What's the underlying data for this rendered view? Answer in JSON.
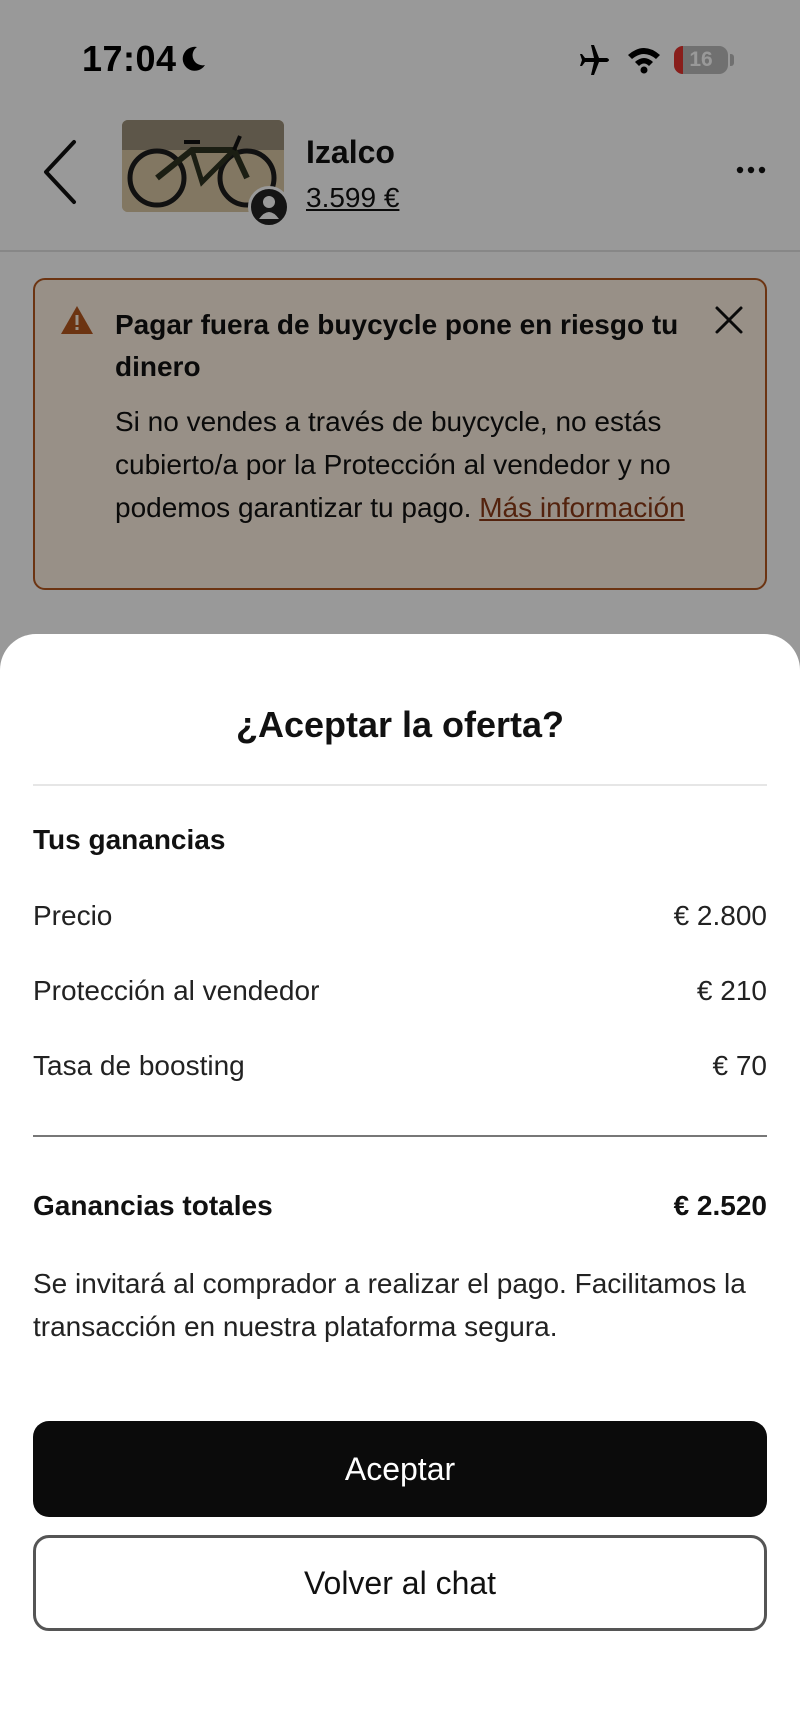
{
  "status_bar": {
    "time": "17:04",
    "battery_level": "16",
    "battery_fraction": 0.16,
    "icons": [
      "moon-icon",
      "airplane-icon",
      "wifi-icon",
      "battery-icon"
    ]
  },
  "header": {
    "back_icon": "chevron-left-icon",
    "product_title": "Izalco",
    "product_price": "3.599 €",
    "more_icon": "ellipsis-icon"
  },
  "warning": {
    "title": "Pagar fuera de buycycle pone en riesgo tu dinero",
    "body": "Si no vendes a través de buycycle, no estás cubierto/a por la Protección al vendedor y no podemos garantizar tu pago.",
    "link": "Más información",
    "icon": "warning-triangle-icon",
    "close_icon": "close-icon"
  },
  "sheet": {
    "title": "¿Aceptar la oferta?",
    "section_label": "Tus ganancias",
    "rows": [
      {
        "label": "Precio",
        "value": "€ 2.800"
      },
      {
        "label": "Protección al vendedor",
        "value": "€ 210"
      },
      {
        "label": "Tasa de boosting",
        "value": "€ 70"
      }
    ],
    "total": {
      "label": "Ganancias totales",
      "value": "€ 2.520"
    },
    "note": "Se invitará al comprador a realizar el pago. Facilitamos la transacción en nuestra plataforma segura.",
    "accept_label": "Aceptar",
    "back_label": "Volver al chat"
  },
  "colors": {
    "warning_border": "#b5571f",
    "warning_background": "#fdf1e2",
    "warning_link": "#8a3a16",
    "primary_button": "#0b0b0b",
    "battery_low": "#e5322d"
  }
}
